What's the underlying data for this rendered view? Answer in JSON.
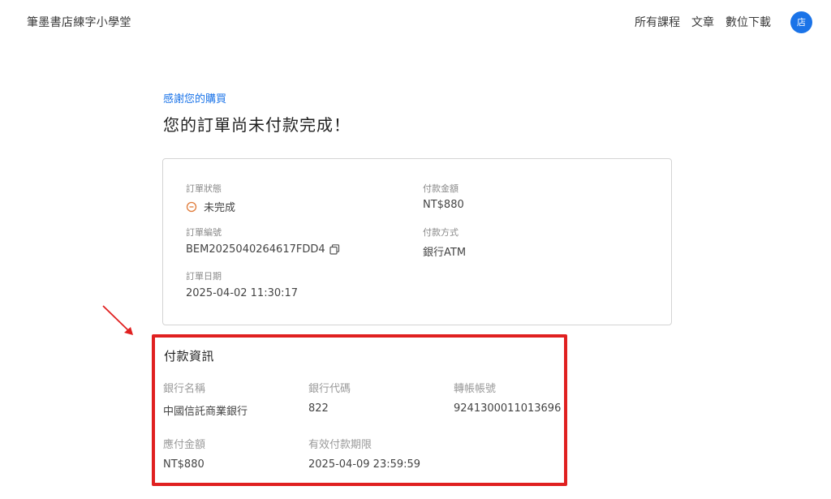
{
  "header": {
    "brand": "筆墨書店練字小學堂",
    "nav": [
      "所有課程",
      "文章",
      "數位下載"
    ],
    "avatar": "店"
  },
  "thanks": "感謝您的購買",
  "order_heading": "您的訂單尚未付款完成！",
  "order": {
    "status_label": "訂單狀態",
    "status_value": "未完成",
    "number_label": "訂單編號",
    "number_value": "BEM2025040264617FDD4",
    "date_label": "訂單日期",
    "date_value": "2025-04-02 11:30:17",
    "amount_label": "付款金額",
    "amount_value": "NT$880",
    "method_label": "付款方式",
    "method_value": "銀行ATM"
  },
  "payment": {
    "title": "付款資訊",
    "bank_name_label": "銀行名稱",
    "bank_name_value": "中國信託商業銀行",
    "bank_code_label": "銀行代碼",
    "bank_code_value": "822",
    "account_label": "轉帳帳號",
    "account_value": "9241300011013696",
    "due_amount_label": "應付金額",
    "due_amount_value": "NT$880",
    "deadline_label": "有效付款期限",
    "deadline_value": "2025-04-09 23:59:59"
  },
  "colors": {
    "accent": "#1a73e8",
    "highlight": "#e02020",
    "status": "#e07b39"
  },
  "icons": {
    "status": "minus-circle-icon",
    "copy": "copy-icon",
    "arrow": "arrow-icon"
  }
}
